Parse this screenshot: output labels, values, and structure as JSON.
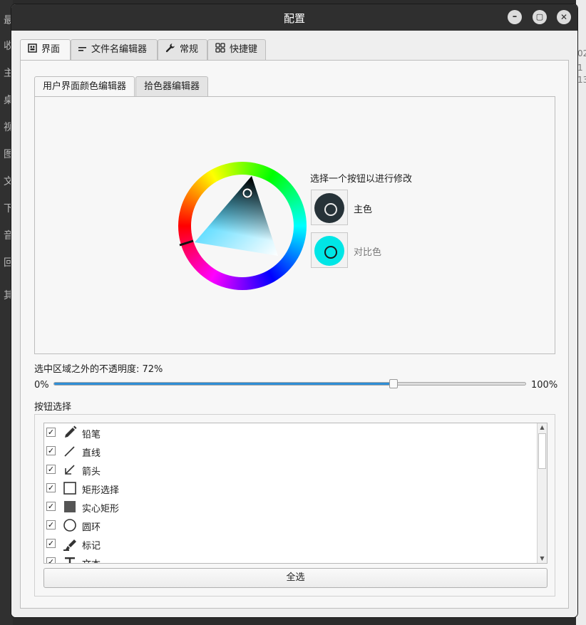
{
  "background": {
    "left_chars": [
      "最",
      "收",
      "主",
      "桌",
      "视",
      "图",
      "文",
      "下",
      "音",
      "回",
      "其"
    ],
    "right_chars": [
      "02",
      "1",
      "13"
    ]
  },
  "window": {
    "title": "配置",
    "controls": [
      "–",
      "▢",
      "✕"
    ]
  },
  "tabs": [
    {
      "label": "界面",
      "icon": "layout-icon"
    },
    {
      "label": "文件名编辑器",
      "icon": "text-lines-icon"
    },
    {
      "label": "常规",
      "icon": "wrench-icon"
    },
    {
      "label": "快捷键",
      "icon": "grid-icon"
    }
  ],
  "inner_tabs": [
    {
      "label": "用户界面颜色编辑器"
    },
    {
      "label": "拾色器编辑器"
    }
  ],
  "color_editor": {
    "prompt": "选择一个按钮以进行修改",
    "primary_label": "主色",
    "contrast_label": "对比色",
    "primary_color": "#263238",
    "contrast_color": "#00e6e6"
  },
  "opacity": {
    "label": "选中区域之外的不透明度:  72%",
    "min_label": "0%",
    "max_label": "100%",
    "value_percent": 72
  },
  "buttons_section": {
    "label": "按钮选择",
    "items": [
      {
        "label": "铅笔",
        "checked": true,
        "icon": "pencil-icon"
      },
      {
        "label": "直线",
        "checked": true,
        "icon": "line-icon"
      },
      {
        "label": "箭头",
        "checked": true,
        "icon": "arrow-icon"
      },
      {
        "label": "矩形选择",
        "checked": true,
        "icon": "rectangle-outline-icon"
      },
      {
        "label": "实心矩形",
        "checked": true,
        "icon": "rectangle-filled-icon"
      },
      {
        "label": "圆环",
        "checked": true,
        "icon": "circle-icon"
      },
      {
        "label": "标记",
        "checked": true,
        "icon": "marker-icon"
      },
      {
        "label": "文本",
        "checked": true,
        "icon": "text-icon"
      }
    ],
    "select_all_label": "全选"
  }
}
